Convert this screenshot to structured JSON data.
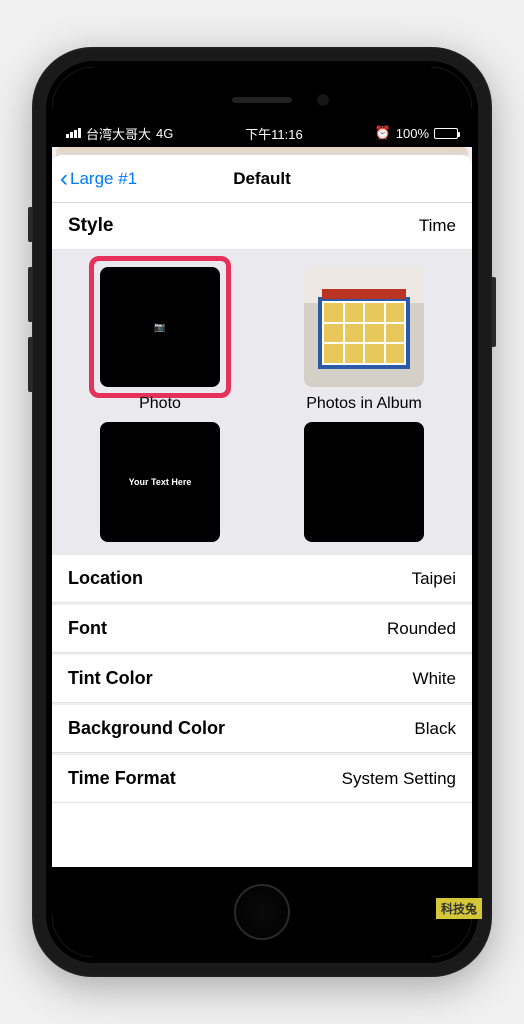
{
  "status": {
    "carrier": "台湾大哥大",
    "network": "4G",
    "time": "下午11:16",
    "alarm_icon": "⏰",
    "battery_pct": "100%"
  },
  "nav": {
    "back_label": "Large #1",
    "title": "Default"
  },
  "style_section": {
    "label": "Style",
    "value": "Time",
    "options": [
      {
        "label": "Photo",
        "thumb_text": ""
      },
      {
        "label": "Photos in Album",
        "thumb_text": ""
      },
      {
        "label": "",
        "thumb_text": "Your Text Here"
      },
      {
        "label": "",
        "thumb_text": ""
      }
    ]
  },
  "settings": [
    {
      "label": "Location",
      "value": "Taipei"
    },
    {
      "label": "Font",
      "value": "Rounded"
    },
    {
      "label": "Tint Color",
      "value": "White"
    },
    {
      "label": "Background Color",
      "value": "Black"
    },
    {
      "label": "Time Format",
      "value": "System Setting"
    }
  ],
  "watermark": "科技兔"
}
